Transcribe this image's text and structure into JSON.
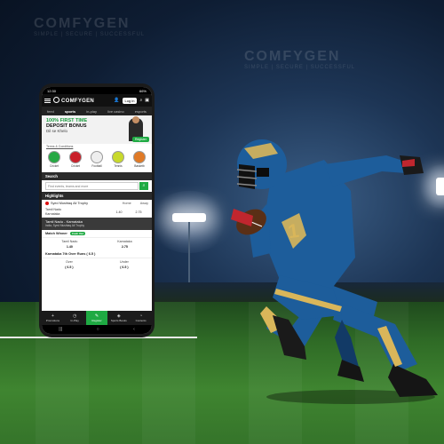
{
  "brand": {
    "watermark": "COMFYGEN",
    "watermark_sub": "SIMPLE | SECURE | SUCCESSFUL",
    "green": "#1faa43",
    "jersey": "#1d5d9b",
    "gold": "#d9b65a"
  },
  "phone": {
    "status_time": "12:30",
    "status_battery": "66%",
    "app_name": "COMFYGEN",
    "login_label": "Log in",
    "tabs": [
      {
        "label": "feed",
        "active": false
      },
      {
        "label": "sports",
        "active": true
      },
      {
        "label": "in-play",
        "active": false
      },
      {
        "label": "live casino",
        "active": false
      },
      {
        "label": "esports",
        "active": false
      }
    ],
    "banner": {
      "line1": "100% FIRST TIME",
      "line2": "DEPOSIT BONUS",
      "line3": "Dil se Khelo",
      "register_label": "Register"
    },
    "terms_label": "Terms & Conditions",
    "sports": [
      {
        "label": "Cricket",
        "icon": "cricket-icon",
        "color": "#27a844"
      },
      {
        "label": "Cricket",
        "icon": "cricket-ball-icon",
        "color": "#c9202a"
      },
      {
        "label": "Football",
        "icon": "football-icon",
        "color": "#eeeeee"
      },
      {
        "label": "Tennis",
        "icon": "tennis-ball-icon",
        "color": "#c8d92c"
      },
      {
        "label": "Basketb",
        "icon": "basketball-icon",
        "color": "#e07a26"
      }
    ],
    "search": {
      "title": "Search",
      "placeholder": "Find events, teams and more"
    },
    "highlights": {
      "title": "Highlights",
      "competition": "Syed Mushtaq Ali Trophy",
      "col_home": "Home",
      "col_away": "Away",
      "team1": "Tamil Nadu",
      "team2": "Karnataka",
      "home_odd": "1.40",
      "away_odd": "2.75"
    },
    "match": {
      "title": "Tamil Nadu - Karnataka",
      "subtitle": "India, Syed Mushtaq Ali Trophy"
    },
    "market1": {
      "title": "Match Winner",
      "badge": "Cash Out",
      "team1": "Tamil Nadu",
      "team2": "Karnataka",
      "odd1": "1.40",
      "odd2": "2.75"
    },
    "market2": {
      "title": "Karnataka 7th Over Runs ( 6.5 )",
      "opt1": "Over",
      "opt2": "Under",
      "val1": "( 6.5 )",
      "val2": "( 6.5 )"
    },
    "bottom_nav": [
      {
        "label": "Promotions",
        "icon": "plus-icon",
        "active": false
      },
      {
        "label": "In-Play",
        "icon": "timer-icon",
        "active": false
      },
      {
        "label": "Register",
        "icon": "register-icon",
        "active": true
      },
      {
        "label": "Sports Books",
        "icon": "gift-icon",
        "active": false
      },
      {
        "label": "Contents",
        "icon": "clock-icon",
        "active": false
      }
    ]
  }
}
